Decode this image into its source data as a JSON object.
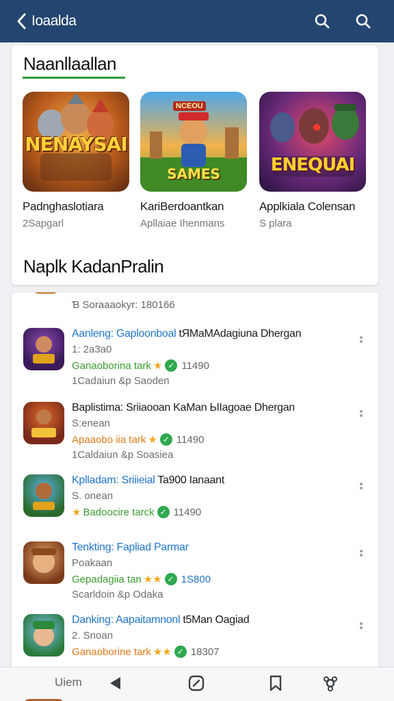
{
  "header": {
    "title": "Ioaalda",
    "back_icon": "chevron-left-icon",
    "search_icon": "search-icon",
    "background": "#24456f"
  },
  "featured": {
    "title": "Naanllaallan",
    "underline_color": "#2e9a3c",
    "items": [
      {
        "art_text": "NENAYSAI",
        "name": "Padnghaslotiara",
        "sub": "2Sapgarl"
      },
      {
        "art_text": "SAMES",
        "art_badge": "NCEOU",
        "name": "KariBerdoantkan",
        "sub": "Apllaiae Ihenmans"
      },
      {
        "art_text": "ENEQUAI",
        "name": "Applkiala Colensan",
        "sub": "S plara"
      }
    ]
  },
  "list_section": {
    "title": "Naplk KadanPralin",
    "partial_meta": "Ɓ Soraaaokyr: 180166",
    "apps": [
      {
        "title_lead": "Aanleng: Gaploonboal",
        "title_rest": " tЯMaMAdagiuna Dhergan",
        "line2": "1: 2a3a0",
        "rating_text": "Ganaoborina tark",
        "stars": "★",
        "count": "11490",
        "line4": "1Cadaiun &p Saoden"
      },
      {
        "title_lead": "Baplistima: Sriiaooan",
        "title_rest": " KaMan ЫIagoae Dhergan",
        "line2": "S:enean",
        "rating_text": "Apaaobo iia tark",
        "stars": "★",
        "count": "11490",
        "line4": "1Caldaiun &p Soasiea"
      },
      {
        "title_lead": "Kplladam: Sriiieial",
        "title_rest": " Ta900 Ianaant",
        "line2": "S. onean",
        "rating_text": "Badoocire tarck",
        "stars": "★",
        "count": "11490",
        "line4": ""
      },
      {
        "title_lead": "Tenkting: Fapliad Parmar",
        "title_rest": "",
        "line2": "Poakaan",
        "rating_text": "Gepadagiia tan",
        "stars": "★★",
        "count": "1S800",
        "line4": "Scarldoin &p Odaka"
      },
      {
        "title_lead": "Danking: Aapaitamnonl",
        "title_rest": " t5Man Oagiad",
        "line2": "2. Snoan",
        "rating_text": "Ganaoborine tark",
        "stars": "★★",
        "count": "18307",
        "line4": ""
      }
    ]
  },
  "bottom_nav": {
    "label": "Uiem",
    "icons": [
      "play-back-icon",
      "compass-icon",
      "bookmark-icon",
      "settings-icon"
    ]
  }
}
